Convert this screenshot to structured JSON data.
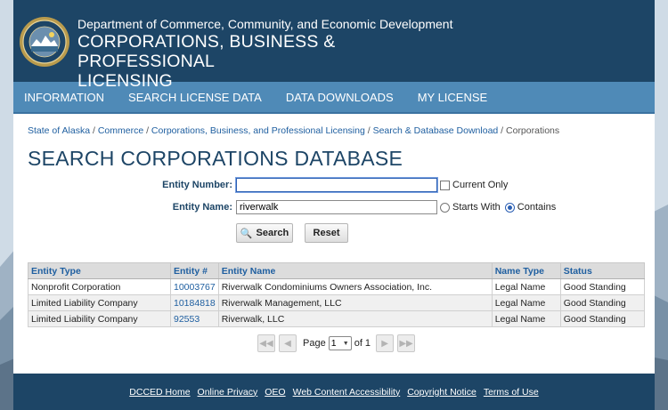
{
  "header": {
    "department": "Department of Commerce, Community, and Economic Development",
    "division_line1": "CORPORATIONS, BUSINESS & PROFESSIONAL",
    "division_line2": "LICENSING",
    "seal_icon": "alaska-state-seal"
  },
  "nav": {
    "items": [
      "INFORMATION",
      "SEARCH LICENSE DATA",
      "DATA DOWNLOADS",
      "MY LICENSE"
    ]
  },
  "breadcrumb": {
    "links": [
      "State of Alaska",
      "Commerce",
      "Corporations, Business, and Professional Licensing",
      "Search & Database Download"
    ],
    "current": "Corporations",
    "separator": "/"
  },
  "page_title": "SEARCH CORPORATIONS DATABASE",
  "form": {
    "entity_number_label": "Entity Number:",
    "entity_number_value": "",
    "current_only_label": "Current Only",
    "current_only_checked": false,
    "entity_name_label": "Entity Name:",
    "entity_name_value": "riverwalk",
    "starts_with_label": "Starts With",
    "contains_label": "Contains",
    "selected_match": "Contains",
    "search_button": "Search",
    "reset_button": "Reset",
    "search_icon": "magnifier-icon"
  },
  "table": {
    "columns": [
      "Entity Type",
      "Entity #",
      "Entity Name",
      "Name Type",
      "Status"
    ],
    "rows": [
      [
        "Nonprofit Corporation",
        "10003767",
        "Riverwalk Condominiums Owners Association, Inc.",
        "Legal Name",
        "Good Standing"
      ],
      [
        "Limited Liability Company",
        "10184818",
        "Riverwalk Management, LLC",
        "Legal Name",
        "Good Standing"
      ],
      [
        "Limited Liability Company",
        "92553",
        "Riverwalk, LLC",
        "Legal Name",
        "Good Standing"
      ]
    ]
  },
  "pager": {
    "page_label": "Page",
    "current_page": "1",
    "of_label": "of 1"
  },
  "footer": {
    "links": [
      "DCCED Home",
      "Online Privacy",
      "OEO",
      "Web Content Accessibility",
      "Copyright Notice",
      "Terms of Use"
    ]
  },
  "colors": {
    "header_bg": "#1d4566",
    "nav_bg": "#4f8ab7",
    "link": "#1f5fa0",
    "title": "#1d4566"
  }
}
